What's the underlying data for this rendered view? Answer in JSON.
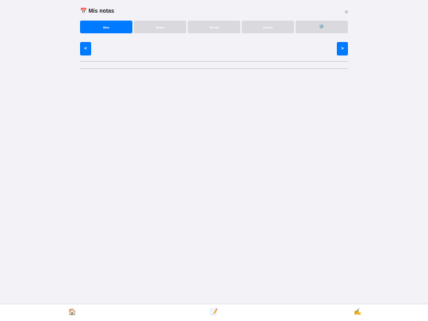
{
  "header": {
    "title_icon": "📅",
    "title": "Mis notas"
  },
  "tabs": [
    {
      "label": "Mes",
      "active": true
    },
    {
      "label": "Notas",
      "active": false
    },
    {
      "label": "Tareas",
      "active": false
    },
    {
      "label": "Nuevo",
      "active": false
    },
    {
      "label": "⚙️",
      "active": false,
      "icon": "gear-icon"
    }
  ],
  "nav": {
    "prev_label": "<",
    "next_label": ">"
  },
  "bottom_nav": {
    "home_icon": "🏠",
    "notes_icon": "📝",
    "write_icon": "✍️"
  },
  "colors": {
    "accent": "#007aff",
    "background": "#f2f2f7",
    "tab_inactive": "#d9d9de"
  }
}
